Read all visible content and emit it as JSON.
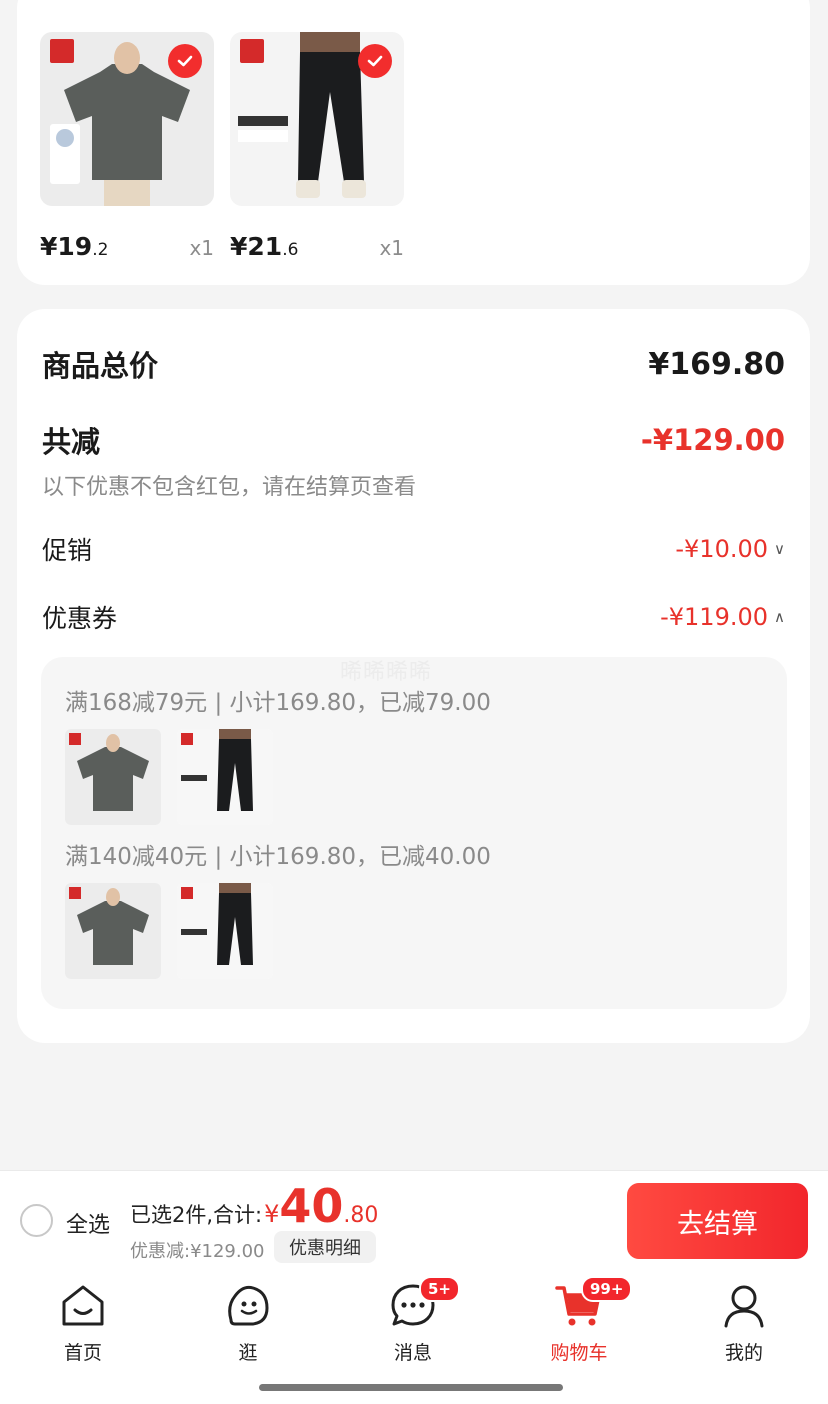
{
  "cart_items": [
    {
      "price_main": "¥19",
      "price_dec": ".2",
      "qty": "x1"
    },
    {
      "price_main": "¥21",
      "price_dec": ".6",
      "qty": "x1"
    }
  ],
  "summary": {
    "total_label": "商品总价",
    "total_value": "¥169.80",
    "reduce_label": "共减",
    "reduce_value": "-¥129.00",
    "hint": "以下优惠不包含红包，请在结算页查看",
    "promo_label": "促销",
    "promo_value": "-¥10.00",
    "coupon_label": "优惠券",
    "coupon_value": "-¥119.00"
  },
  "coupons": [
    {
      "text": "满168减79元 | 小计169.80，已减79.00"
    },
    {
      "text": "满140减40元 | 小计169.80，已减40.00"
    }
  ],
  "watermark": "晞晞晞晞",
  "bottom": {
    "select_all": "全选",
    "selected_prefix": "已选2件,合计:",
    "currency": "¥",
    "total_int": "40",
    "total_dec": ".80",
    "discount": "优惠减:¥129.00",
    "detail_btn": "优惠明细",
    "checkout": "去结算"
  },
  "tabs": [
    {
      "label": "首页",
      "icon": "home-icon"
    },
    {
      "label": "逛",
      "icon": "stroll-icon"
    },
    {
      "label": "消息",
      "icon": "message-icon",
      "badge": "5+"
    },
    {
      "label": "购物车",
      "icon": "cart-icon",
      "badge": "99+"
    },
    {
      "label": "我的",
      "icon": "profile-icon"
    }
  ],
  "colors": {
    "accent": "#e8322b",
    "checkout": "#f2262c"
  }
}
